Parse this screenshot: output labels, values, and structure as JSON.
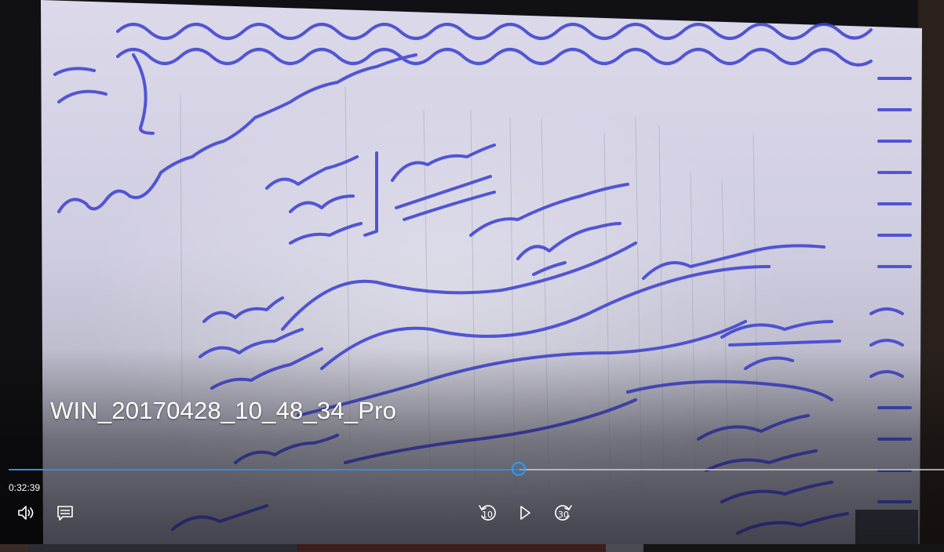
{
  "video": {
    "title": "WIN_20170428_10_48_34_Pro",
    "current_time": "0:32:39",
    "progress_fraction": 0.546
  },
  "controls": {
    "volume_icon": "volume-icon",
    "captions_icon": "captions-icon",
    "skip_back_icon": "skip-back-10-icon",
    "skip_back_label": "10",
    "play_icon": "play-icon",
    "skip_forward_icon": "skip-forward-30-icon",
    "skip_forward_label": "30"
  },
  "colors": {
    "progress_accent": "#2f8fdc",
    "ink": "#3a3fd0",
    "paper": "#d9d6e6"
  }
}
